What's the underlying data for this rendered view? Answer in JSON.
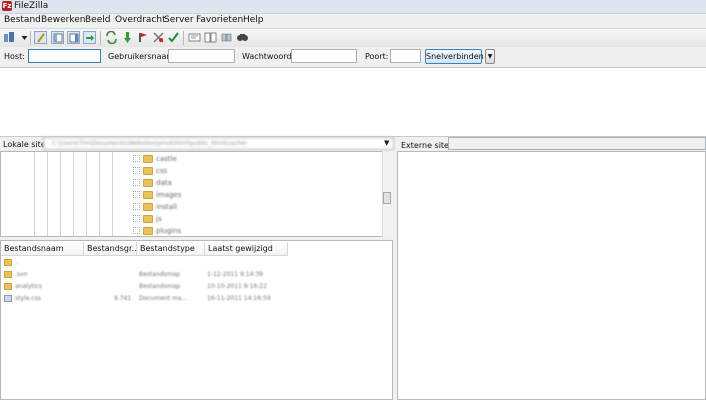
{
  "window": {
    "title": "FileZilla",
    "app_icon_letter": "Fz"
  },
  "menu": [
    "Bestand",
    "Bewerken",
    "Beeld",
    "Overdracht",
    "Server",
    "Favorieten",
    "Help"
  ],
  "toolbar": {
    "icons": [
      "site-manager-icon",
      "dropdown-arrow-icon",
      "toggle-log-icon",
      "toggle-local-tree-icon",
      "toggle-remote-tree-icon",
      "toggle-queue-icon",
      "refresh-icon",
      "process-queue-icon",
      "cancel-icon",
      "disconnect-icon",
      "reconnect-icon",
      "filter-icon",
      "compare-icon",
      "sync-browse-icon",
      "search-icon"
    ]
  },
  "quickconnect": {
    "host_label": "Host:",
    "host_value": "",
    "user_label": "Gebruikersnaam:",
    "user_value": "",
    "password_label": "Wachtwoord:",
    "password_value": "",
    "port_label": "Poort:",
    "port_value": "",
    "button_label": "Snelverbinden",
    "dropdown_glyph": "▼"
  },
  "local": {
    "label": "Lokale site:",
    "path": "C:\\Users\\Tim\\Documents\\Websites\\privé\\html\\public_html\\cache\\",
    "dropdown_glyph": "▼",
    "tree": [
      "castle",
      "css",
      "data",
      "images",
      "install",
      "js",
      "plugins"
    ],
    "columns": [
      "Bestandsnaam",
      "Bestandsgr...",
      "Bestandstype",
      "Laatst gewijzigd"
    ],
    "files": [
      {
        "name": "..",
        "size": "",
        "type": "",
        "modified": "",
        "icon": "folder-up-icon"
      },
      {
        "name": ".svn",
        "size": "",
        "type": "Bestandsmap",
        "modified": "1-12-2011 9:14:39",
        "icon": "folder-icon"
      },
      {
        "name": "analytics",
        "size": "",
        "type": "Bestandsmap",
        "modified": "10-10-2011 9:16:22",
        "icon": "folder-icon"
      },
      {
        "name": "style.css",
        "size": "9.741",
        "type": "Document ma...",
        "modified": "16-11-2011 14:16:59",
        "icon": "document-icon"
      }
    ]
  },
  "remote": {
    "label": "Externe site:",
    "path": ""
  }
}
